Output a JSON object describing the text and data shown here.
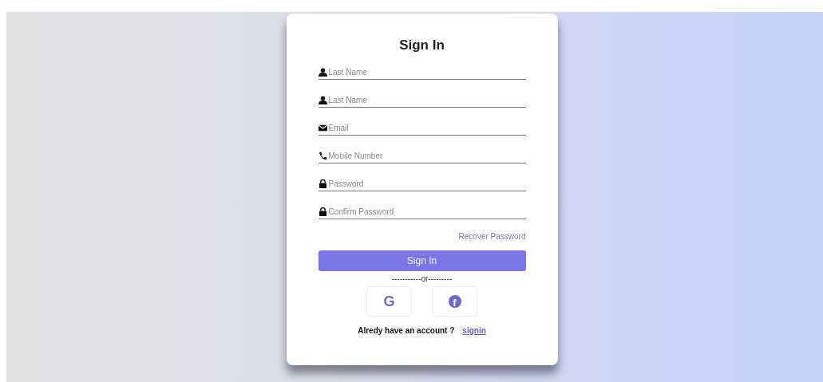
{
  "title": "Sign In",
  "fields": [
    {
      "kind": "user",
      "placeholder": "Last Name"
    },
    {
      "kind": "user",
      "placeholder": "Last Name"
    },
    {
      "kind": "email",
      "placeholder": "Email"
    },
    {
      "kind": "phone",
      "placeholder": "Mobile Number"
    },
    {
      "kind": "lock",
      "placeholder": "Password"
    },
    {
      "kind": "lock",
      "placeholder": "Confirm Password"
    }
  ],
  "recover_link": "Recover Password",
  "submit_button": "Sign In",
  "divider": "-----------or---------",
  "social_buttons": [
    {
      "kind": "letter",
      "label": "G"
    },
    {
      "kind": "circle",
      "label": "f"
    }
  ],
  "footer": {
    "text": "Alredy have an account ?",
    "link": "signin"
  }
}
